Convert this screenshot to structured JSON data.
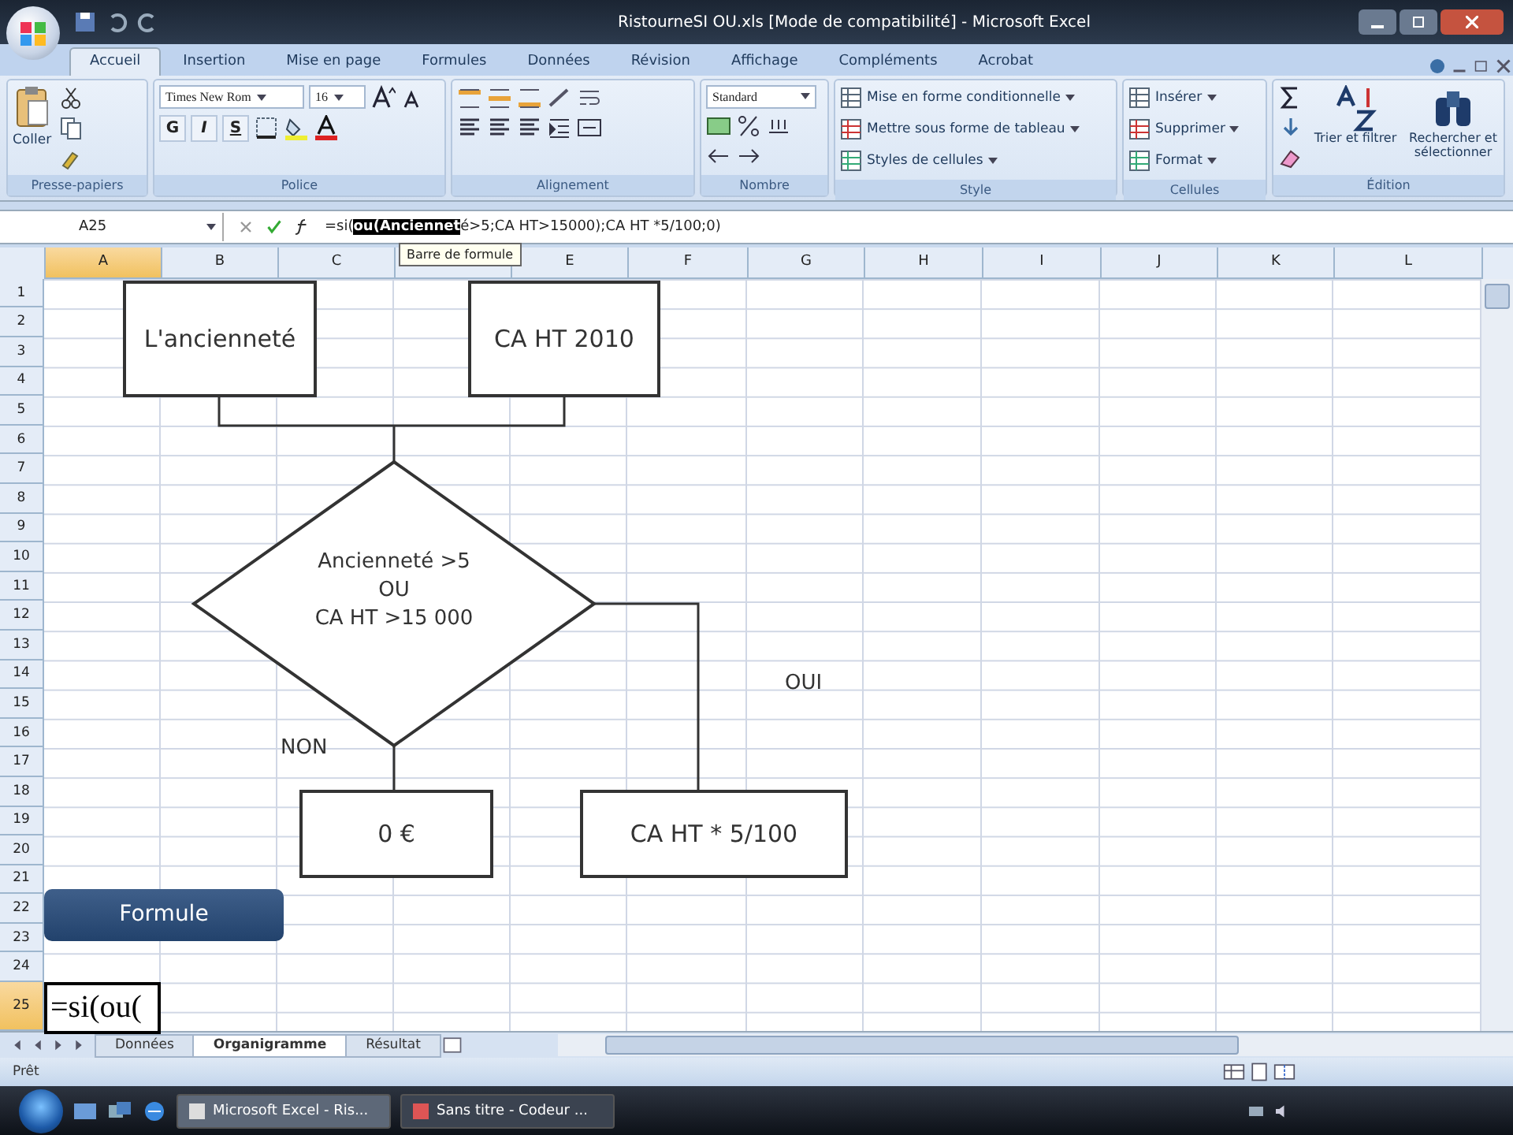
{
  "window": {
    "title": "RistourneSI OU.xls [Mode de compatibilité] - Microsoft Excel"
  },
  "ribbon_tabs": [
    {
      "label": "Accueil",
      "selected": true
    },
    {
      "label": "Insertion",
      "selected": false
    },
    {
      "label": "Mise en page",
      "selected": false
    },
    {
      "label": "Formules",
      "selected": false
    },
    {
      "label": "Données",
      "selected": false
    },
    {
      "label": "Révision",
      "selected": false
    },
    {
      "label": "Affichage",
      "selected": false
    },
    {
      "label": "Compléments",
      "selected": false
    },
    {
      "label": "Acrobat",
      "selected": false
    }
  ],
  "ribbon_groups": [
    {
      "kind": "clipboard",
      "label": "Presse-papiers",
      "paste": "Coller"
    },
    {
      "kind": "font",
      "label": "Police",
      "font": "Times New Rom",
      "size": "16",
      "styles": [
        "G",
        "I",
        "S"
      ]
    },
    {
      "kind": "alignment",
      "label": "Alignement"
    },
    {
      "kind": "number",
      "label": "Nombre",
      "format": "Standard"
    },
    {
      "kind": "list",
      "label": "Style",
      "items": [
        "Mise en forme conditionnelle",
        "Mettre sous forme de tableau",
        "Styles de cellules"
      ]
    },
    {
      "kind": "list",
      "label": "Cellules",
      "items": [
        "Insérer",
        "Supprimer",
        "Format"
      ]
    },
    {
      "kind": "editing",
      "label": "Édition",
      "items": [
        "Trier et filtrer",
        "Rechercher et sélectionner"
      ]
    }
  ],
  "formula_bar": {
    "name_box": "A25",
    "formula_before": "=si(",
    "formula_selected": "ou(Anciennet",
    "formula_after": "é>5;CA HT>15000);CA HT *5/100;0)",
    "tooltip": "Barre de formule"
  },
  "columns": [
    {
      "label": "A",
      "selected": true
    },
    {
      "label": "B",
      "selected": false
    },
    {
      "label": "C",
      "selected": false
    },
    {
      "selected": false
    },
    {
      "label": "E",
      "selected": false
    },
    {
      "label": "F",
      "selected": false
    },
    {
      "label": "G",
      "selected": false
    },
    {
      "label": "H",
      "selected": false
    },
    {
      "label": "I",
      "selected": false
    },
    {
      "label": "J",
      "selected": false
    },
    {
      "label": "K",
      "selected": false
    },
    {
      "label": "L",
      "selected": false
    }
  ],
  "rows": [
    {
      "label": "1",
      "selected": false
    },
    {
      "label": "2",
      "selected": false
    },
    {
      "label": "3",
      "selected": false
    },
    {
      "label": "4",
      "selected": false
    },
    {
      "label": "5",
      "selected": false
    },
    {
      "label": "6",
      "selected": false
    },
    {
      "label": "7",
      "selected": false
    },
    {
      "label": "8",
      "selected": false
    },
    {
      "label": "9",
      "selected": false
    },
    {
      "label": "10",
      "selected": false
    },
    {
      "label": "11",
      "selected": false
    },
    {
      "label": "12",
      "selected": false
    },
    {
      "label": "13",
      "selected": false
    },
    {
      "label": "14",
      "selected": false
    },
    {
      "label": "15",
      "selected": false
    },
    {
      "label": "16",
      "selected": false
    },
    {
      "label": "17",
      "selected": false
    },
    {
      "label": "18",
      "selected": false
    },
    {
      "label": "19",
      "selected": false
    },
    {
      "label": "20",
      "selected": false
    },
    {
      "label": "21",
      "selected": false
    },
    {
      "label": "22",
      "selected": false
    },
    {
      "label": "23",
      "selected": false
    },
    {
      "label": "24",
      "selected": false
    },
    {
      "label": "25",
      "selected": true
    }
  ],
  "active_cell": {
    "value": "=si(ou("
  },
  "diagram": {
    "top_left_box": "L'ancienneté",
    "top_right_box": "CA HT 2010",
    "decision": {
      "lines": [
        "Ancienneté >5",
        "OU",
        "CA HT >15 000"
      ]
    },
    "no_label": "NON",
    "yes_label": "OUI",
    "no_box": "0 €",
    "yes_box": "CA HT * 5/100",
    "caption_button": "Formule"
  },
  "sheet_tabs": [
    {
      "label": "Données",
      "selected": false
    },
    {
      "label": "Organigramme",
      "selected": true
    },
    {
      "label": "Résultat",
      "selected": false
    }
  ],
  "status_bar": {
    "text": "Prêt"
  },
  "taskbar": {
    "buttons": [
      {
        "label": "Microsoft Excel - Ris...",
        "selected": true
      },
      {
        "label": "Sans titre - Codeur ...",
        "selected": false
      }
    ]
  }
}
